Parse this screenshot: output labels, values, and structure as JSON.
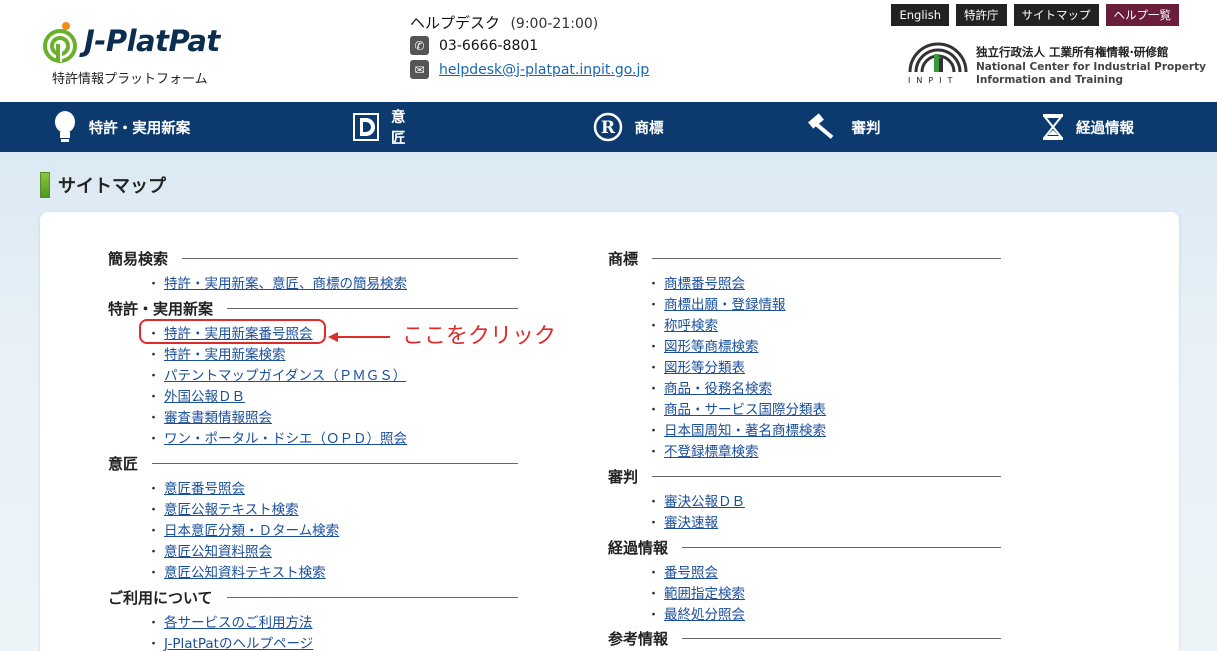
{
  "header": {
    "logo_text": "J-PlatPat",
    "logo_sub": "特許情報プラットフォーム",
    "helpdesk_title": "ヘルプデスク",
    "helpdesk_hours": "(9:00-21:00)",
    "phone": "03-6666-8801",
    "email": "helpdesk@j-platpat.inpit.go.jp",
    "top_buttons": [
      "English",
      "特許庁",
      "サイトマップ",
      "ヘルプ一覧"
    ],
    "inpit_label": "INPIT",
    "inpit_jp": "独立行政法人 工業所有権情報·研修館",
    "inpit_en_1": "National Center for Industrial Property",
    "inpit_en_2": "Information and Training"
  },
  "nav": {
    "items": [
      {
        "label": "特許・実用新案",
        "icon": "lightbulb-icon"
      },
      {
        "label": "意匠",
        "icon": "design-d-icon"
      },
      {
        "label": "商標",
        "icon": "trademark-r-icon"
      },
      {
        "label": "審判",
        "icon": "gavel-icon"
      },
      {
        "label": "経過情報",
        "icon": "hourglass-icon"
      }
    ]
  },
  "page": {
    "title": "サイトマップ"
  },
  "left": {
    "simple": {
      "title": "簡易検索",
      "links": [
        "特許・実用新案、意匠、商標の簡易検索"
      ]
    },
    "patent": {
      "title": "特許・実用新案",
      "links": [
        "特許・実用新案番号照会",
        "特許・実用新案検索",
        "パテントマップガイダンス（ＰＭＧＳ）",
        "外国公報ＤＢ",
        "審査書類情報照会",
        "ワン・ポータル・ドシエ（ＯＰＤ）照会"
      ]
    },
    "design": {
      "title": "意匠",
      "links": [
        "意匠番号照会",
        "意匠公報テキスト検索",
        "日本意匠分類・Ｄターム検索",
        "意匠公知資料照会",
        "意匠公知資料テキスト検索"
      ]
    },
    "usage": {
      "title": "ご利用について",
      "links": [
        "各サービスのご利用方法",
        "J-PlatPatのヘルプページ"
      ]
    }
  },
  "right": {
    "trademark": {
      "title": "商標",
      "links": [
        "商標番号照会",
        "商標出願・登録情報",
        "称呼検索",
        "図形等商標検索",
        "図形等分類表",
        "商品・役務名検索",
        "商品・サービス国際分類表",
        "日本国周知・著名商標検索",
        "不登録標章検索"
      ]
    },
    "trial": {
      "title": "審判",
      "links": [
        "審決公報ＤＢ",
        "審決速報"
      ]
    },
    "progress": {
      "title": "経過情報",
      "links": [
        "番号照会",
        "範囲指定検索",
        "最終処分照会"
      ]
    },
    "reference": {
      "title": "参考情報",
      "links": []
    }
  },
  "annotation": {
    "text": "ここをクリック",
    "color": "#e02b2b"
  },
  "colors": {
    "nav_bg": "#0d3a6e",
    "link": "#1a4f9c",
    "help_button": "#6b1e3c"
  }
}
